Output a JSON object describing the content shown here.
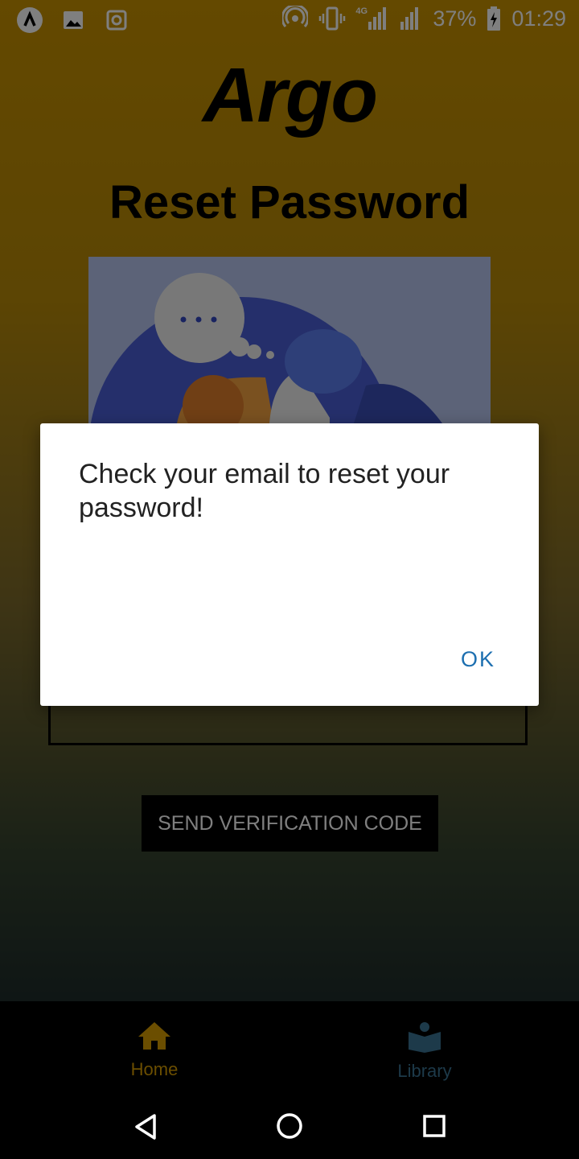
{
  "status_bar": {
    "battery": "37%",
    "time": "01:29",
    "network_label": "4G",
    "icons": [
      "app-icon",
      "image-icon",
      "screenshot-icon",
      "hotspot-icon",
      "vibrate-icon",
      "signal-icon",
      "signal-icon",
      "battery-icon"
    ]
  },
  "page": {
    "logo": "Argo",
    "title": "Reset Password",
    "send_button_label": "SEND VERIFICATION CODE"
  },
  "dialog": {
    "message": "Check your email to reset your password!",
    "ok_label": "OK"
  },
  "bottom_nav": {
    "items": [
      {
        "label": "Home",
        "icon": "home-icon"
      },
      {
        "label": "Library",
        "icon": "library-icon"
      }
    ]
  },
  "system_nav": {
    "icons": [
      "back-icon",
      "home-circle-icon",
      "recents-icon"
    ]
  },
  "colors": {
    "accent": "#1d6fb0",
    "bottom_nav_active": "#6b4e00",
    "bottom_nav_inactive": "#1d3a4a"
  }
}
